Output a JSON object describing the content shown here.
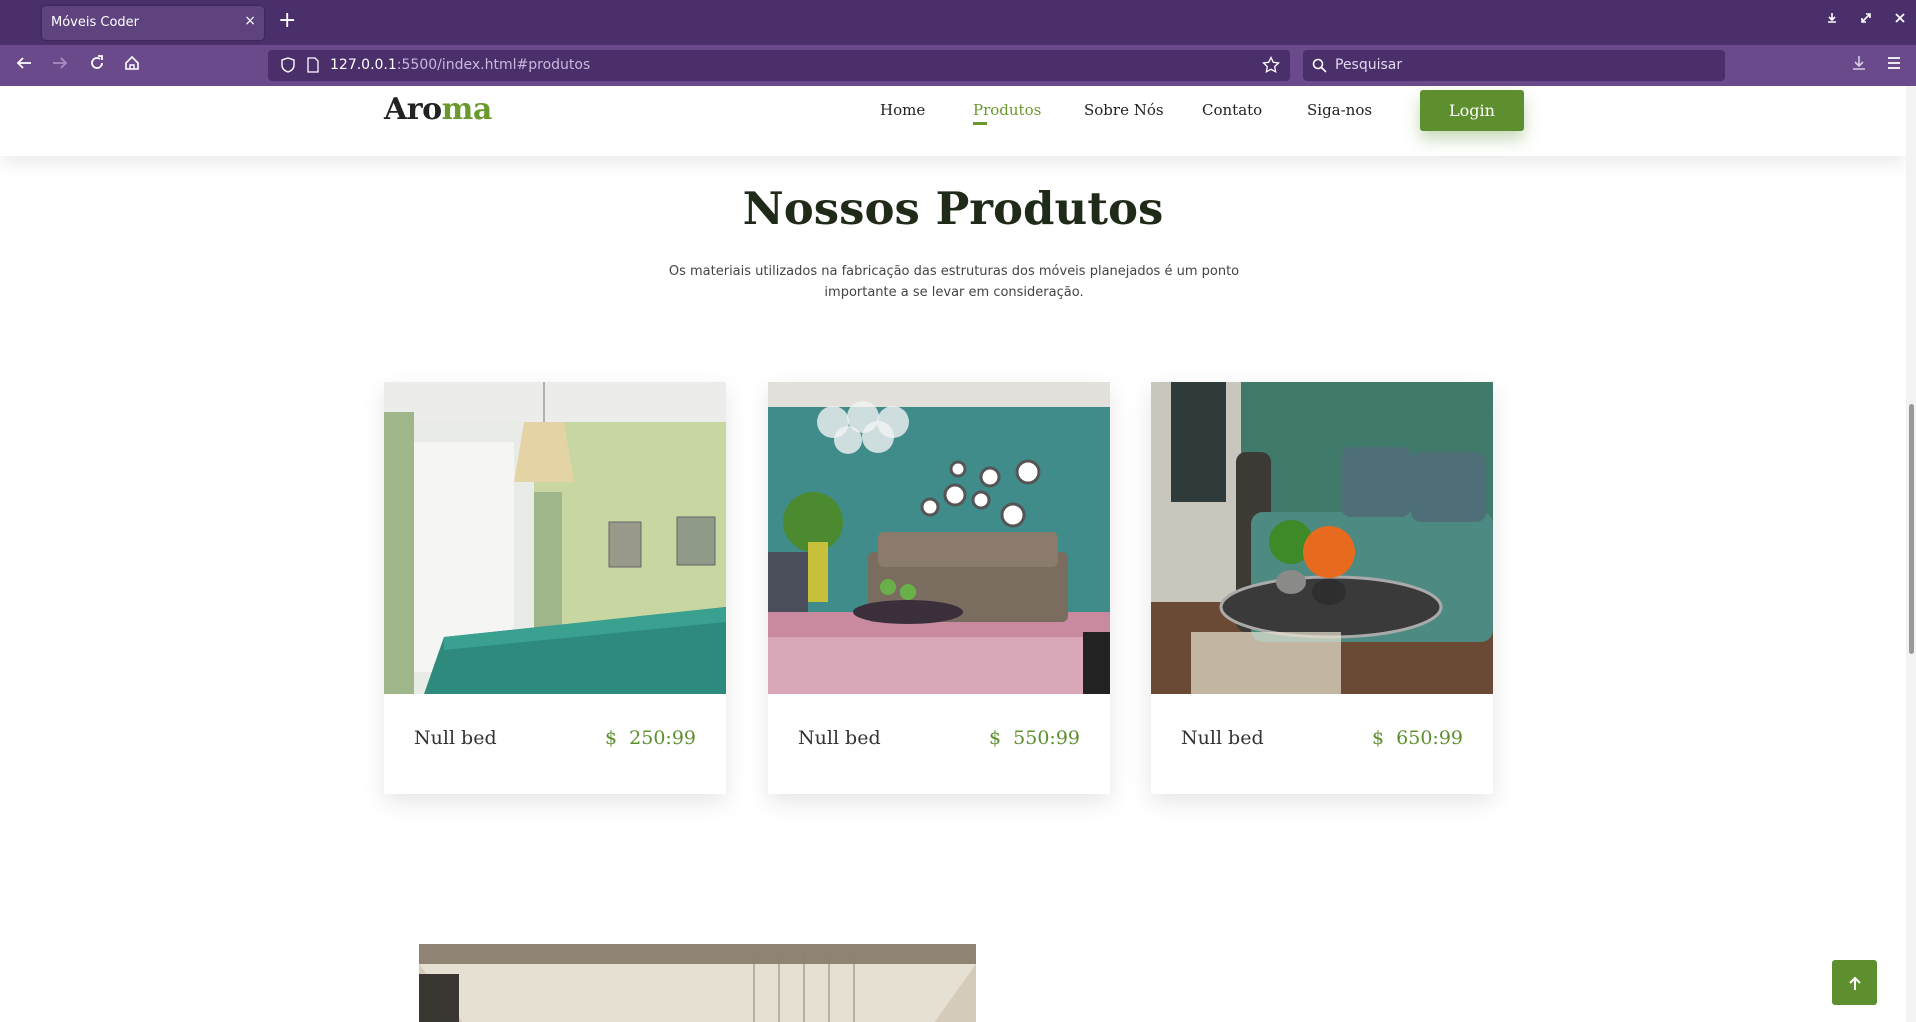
{
  "browser": {
    "tab_title": "Móveis Coder",
    "tab_close": "×",
    "new_tab": "+",
    "url_host": "127.0.0.1",
    "url_rest": ":5500/index.html#produtos",
    "search_placeholder": "Pesquisar"
  },
  "site": {
    "logo_main": "Aro",
    "logo_accent": "ma",
    "nav": [
      "Home",
      "Produtos",
      "Sobre Nós",
      "Contato",
      "Siga-nos"
    ],
    "active_nav": "Produtos",
    "login_label": "Login",
    "accent_color": "#5d8f2e"
  },
  "products_section": {
    "title": "Nossos Produtos",
    "subtitle": "Os materiais utilizados na fabricação das estruturas dos móveis planejados é um ponto importante a se levar em consideração.",
    "items": [
      {
        "name": "Null bed",
        "price": "$  250:99"
      },
      {
        "name": "Null bed",
        "price": "$  550:99"
      },
      {
        "name": "Null bed",
        "price": "$  650:99"
      }
    ]
  },
  "scroll_top_icon": "arrow-up-icon"
}
